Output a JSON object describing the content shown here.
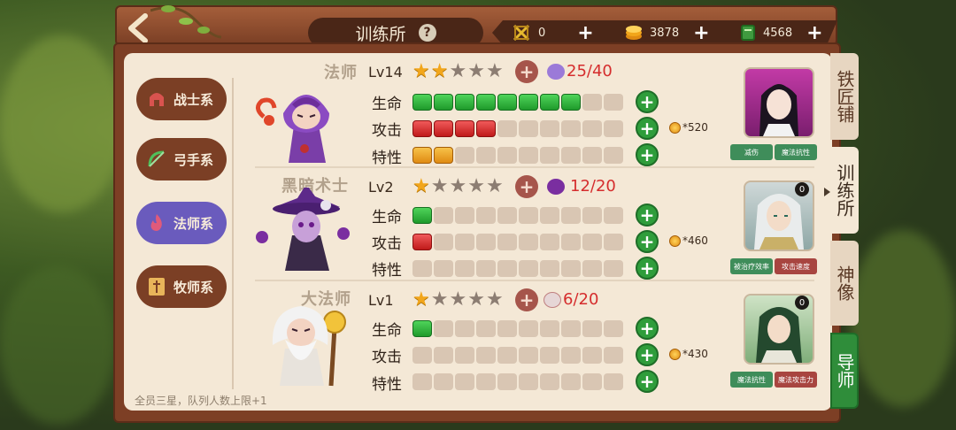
{
  "header": {
    "title": "训练所",
    "help": "?",
    "resources": [
      {
        "icon": "crystal-icon",
        "value": "0"
      },
      {
        "icon": "coin-stack-icon",
        "value": "3878"
      },
      {
        "icon": "book-icon",
        "value": "4568"
      }
    ]
  },
  "class_tabs": [
    {
      "label": "战士系",
      "icon": "helmet-icon",
      "color": "#7b3f25"
    },
    {
      "label": "弓手系",
      "icon": "bow-icon",
      "color": "#7b3f25"
    },
    {
      "label": "法师系",
      "icon": "flame-icon",
      "color": "#6a5bbd",
      "active": true
    },
    {
      "label": "牧师系",
      "icon": "scroll-icon",
      "color": "#7b3f25"
    }
  ],
  "heroes": [
    {
      "name": "法师",
      "level": "Lv14",
      "stars": 2,
      "max_stars": 5,
      "fragments": "25/40",
      "stats": [
        {
          "label": "生命",
          "filled": 8,
          "color": "g"
        },
        {
          "label": "攻击",
          "filled": 4,
          "color": "r"
        },
        {
          "label": "特性",
          "filled": 2,
          "color": "o"
        }
      ],
      "cost": "*520",
      "traits": [
        "减伤",
        "魔法抗性"
      ]
    },
    {
      "name": "黑暗术士",
      "level": "Lv2",
      "stars": 1,
      "max_stars": 5,
      "fragments": "12/20",
      "stats": [
        {
          "label": "生命",
          "filled": 1,
          "color": "g"
        },
        {
          "label": "攻击",
          "filled": 1,
          "color": "r"
        },
        {
          "label": "特性",
          "filled": 0,
          "color": "o"
        }
      ],
      "cost": "*460",
      "badge": "0",
      "traits": [
        "被治疗效率",
        "攻击速度"
      ]
    },
    {
      "name": "大法师",
      "level": "Lv1",
      "stars": 1,
      "max_stars": 5,
      "fragments": "6/20",
      "stats": [
        {
          "label": "生命",
          "filled": 1,
          "color": "g"
        },
        {
          "label": "攻击",
          "filled": 0,
          "color": "r"
        },
        {
          "label": "特性",
          "filled": 0,
          "color": "o"
        }
      ],
      "cost": "*430",
      "badge": "0",
      "traits": [
        "魔法抗性",
        "魔法攻击力"
      ]
    }
  ],
  "side_tabs": [
    {
      "label": "铁匠铺"
    },
    {
      "label": "训练所",
      "active": true
    },
    {
      "label": "神像"
    },
    {
      "label": "导师",
      "highlight": true
    }
  ],
  "footer_note": "全员三星，队列人数上限+1"
}
